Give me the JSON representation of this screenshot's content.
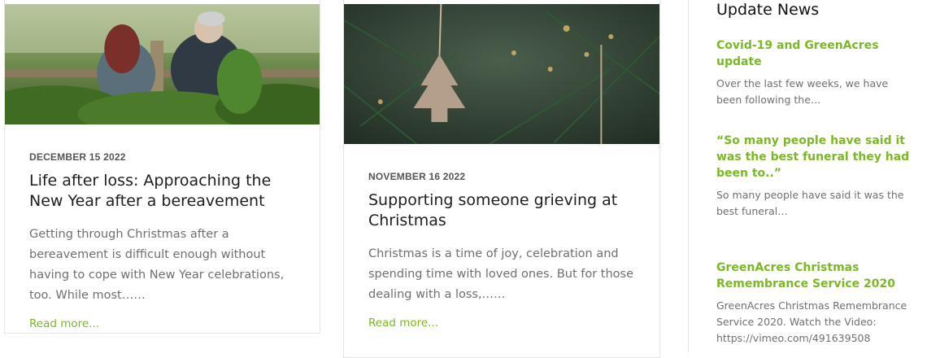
{
  "posts": [
    {
      "date": "DECEMBER 15 2022",
      "title": "Life after loss: Approaching the New Year after a bereavement",
      "excerpt": "Getting through Christmas after a bereavement is difficult enough without having to cope with New Year celebrations, too. While most……",
      "read_more": "Read more..."
    },
    {
      "date": "NOVEMBER 16 2022",
      "title": "Supporting someone grieving at Christmas",
      "excerpt": "Christmas is a time of joy, celebration and spending time with loved ones. But for those dealing with a loss,……",
      "read_more": "Read more..."
    }
  ],
  "sidebar": {
    "heading": "Update News",
    "items": [
      {
        "title": "Covid-19 and GreenAcres update",
        "excerpt": "Over the last few weeks, we have been following the…"
      },
      {
        "title": "“So many people have said it was the best funeral they had been to..”",
        "excerpt": "So many people have said it was the best funeral…"
      },
      {
        "title": "GreenAcres Christmas Remembrance Service 2020",
        "excerpt": "GreenAcres Christmas Remembrance Service 2020. Watch the Video: https://vimeo.com/491639508"
      }
    ]
  },
  "colors": {
    "accent": "#7ab826"
  }
}
